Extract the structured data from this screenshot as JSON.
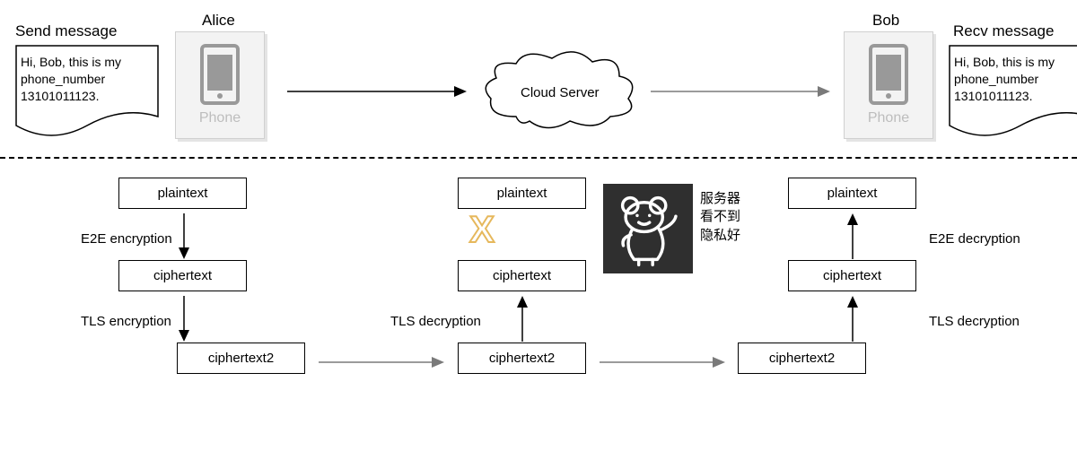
{
  "top": {
    "send_label": "Send message",
    "recv_label": "Recv message",
    "alice": "Alice",
    "bob": "Bob",
    "phone_caption": "Phone",
    "cloud_label": "Cloud Server",
    "message_text": "Hi, Bob, this is my phone_number 13101011123."
  },
  "bottom": {
    "left": {
      "plaintext": "plaintext",
      "e2e_enc": "E2E encryption",
      "ciphertext": "ciphertext",
      "tls_enc": "TLS encryption",
      "ciphertext2": "ciphertext2"
    },
    "middle": {
      "plaintext": "plaintext",
      "ciphertext": "ciphertext",
      "tls_dec": "TLS decryption",
      "ciphertext2": "ciphertext2"
    },
    "right": {
      "plaintext": "plaintext",
      "e2e_dec": "E2E decryption",
      "ciphertext": "ciphertext",
      "tls_dec": "TLS decryption",
      "ciphertext2": "ciphertext2"
    },
    "cn_line1": "服务器",
    "cn_line2": "看不到",
    "cn_line3": "隐私好"
  }
}
